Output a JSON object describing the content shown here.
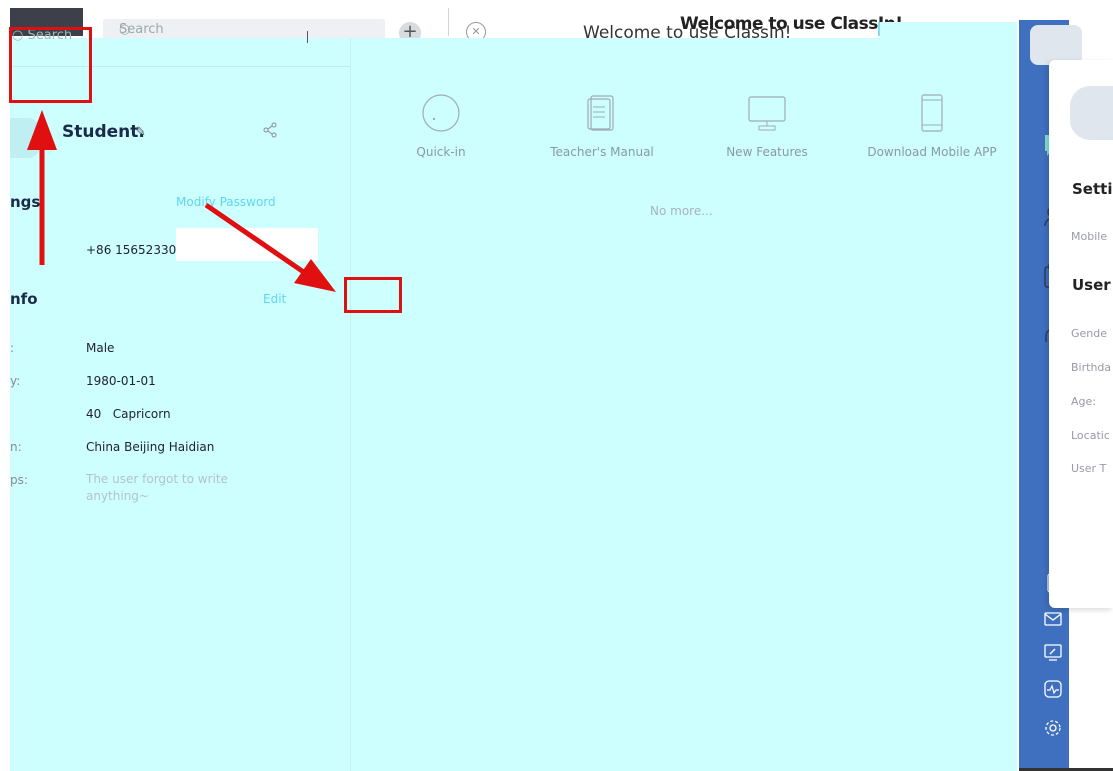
{
  "window": {
    "title": "Welcome to use ClassIn!",
    "title_overlap": "Welcome to use ClassIn!"
  },
  "search": {
    "placeholder": "Search",
    "left_placeholder": "Search"
  },
  "profile": {
    "name": "Student.",
    "settings_heading": "ngs",
    "modify_password": "Modify Password",
    "phone": "+86 15652330",
    "info_heading": "nfo",
    "edit_label": "Edit",
    "fields": [
      {
        "label": ":",
        "value": "Male"
      },
      {
        "label": "y:",
        "value": "1980-01-01"
      },
      {
        "label": "",
        "value": "40   Capricorn"
      },
      {
        "label": "n:",
        "value": "China Beijing Haidian"
      },
      {
        "label": "ps:",
        "value": ""
      }
    ],
    "tips": "The user forgot to write anything~"
  },
  "toolbar": {
    "items": [
      {
        "label": "Quick-in",
        "icon": "quick-in-icon"
      },
      {
        "label": "Teacher's Manual",
        "icon": "manual-icon"
      },
      {
        "label": "New Features",
        "icon": "monitor-icon"
      },
      {
        "label": "Download Mobile APP",
        "icon": "mobile-icon"
      }
    ],
    "no_more": "No more..."
  },
  "side_panel": {
    "setting": "Settir",
    "mobile": "Mobile",
    "user": "User",
    "labels": [
      "Gende",
      "Birthda",
      "Age:",
      "Locatic",
      "User T"
    ]
  },
  "colors": {
    "overlay": "#ccfffe",
    "sidebar": "#3f70bf",
    "accent_link": "#5fd7f0",
    "annotation_red": "#e01010"
  }
}
